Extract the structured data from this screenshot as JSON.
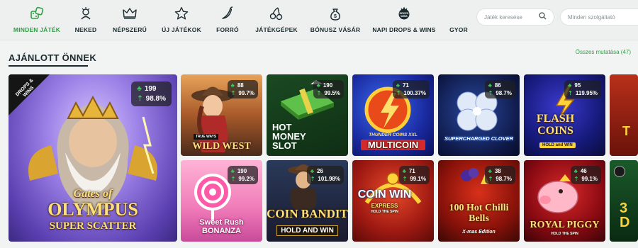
{
  "nav": [
    {
      "label": "MINDEN JÁTÉK",
      "icon": "dice-icon",
      "active": true
    },
    {
      "label": "NEKED",
      "icon": "person-star-icon"
    },
    {
      "label": "NÉPSZERŰ",
      "icon": "crown-icon"
    },
    {
      "label": "ÚJ JÁTÉKOK",
      "icon": "star-icon"
    },
    {
      "label": "FORRÓ",
      "icon": "chili-icon"
    },
    {
      "label": "JÁTÉKGÉPEK",
      "icon": "cherries-icon"
    },
    {
      "label": "BÓNUSZ VÁSÁR",
      "icon": "money-bag-icon"
    },
    {
      "label": "NAPI DROPS & WINS",
      "icon": "drops-wins-icon"
    },
    {
      "label": "GYOR",
      "icon": ""
    }
  ],
  "search": {
    "games_placeholder": "Játék keresése",
    "providers_placeholder": "Minden szolgáltató"
  },
  "section": {
    "title": "AJÁNLOTT ÖNNEK",
    "show_all": "Összes mutatása  (47)"
  },
  "featured": {
    "title_top": "Gates of",
    "title_mid": "OLYMPUS",
    "title_bot": "SUPER SCATTER",
    "players": "199",
    "rtp": "98.8%",
    "ribbon": "DROPS & WINS"
  },
  "games": [
    {
      "title": "WILD WEST",
      "players": "88",
      "rtp": "99.7%"
    },
    {
      "title": "HOT MONEY SLOT",
      "players": "190",
      "rtp": "99.5%"
    },
    {
      "title": "MULTICOIN",
      "players": "71",
      "rtp": "100.37%"
    },
    {
      "title": "SUPERCHARGED CLOVER",
      "players": "86",
      "rtp": "98.7%"
    },
    {
      "title": "FLASH COINS",
      "players": "95",
      "rtp": "119.95%"
    },
    {
      "title": "Sweet Rush BONANZA",
      "players": "190",
      "rtp": "99.2%"
    },
    {
      "title": "COIN BANDIT",
      "players": "26",
      "rtp": "101.98%"
    },
    {
      "title": "COIN WIN",
      "players": "71",
      "rtp": "99.1%"
    },
    {
      "title": "100 Hot Chilli Bells",
      "players": "38",
      "rtp": "98.7%"
    },
    {
      "title": "ROYAL PIGGY",
      "players": "46",
      "rtp": "99.1%"
    }
  ],
  "tile_subs": {
    "wildwest": "TRUE WAYS",
    "multicoin": "THUNDER COINS XXL",
    "flash": "HOLD and WIN",
    "bandit": "HOLD AND WIN",
    "coinwin": "EXPRESS",
    "coinwin_hold": "HOLD THE SPIN",
    "chilli": "X-mas Edition",
    "piggy": "HOLD THE SPIN"
  },
  "colors": {
    "accent": "#2e9e44",
    "text": "#1b2a2e"
  }
}
